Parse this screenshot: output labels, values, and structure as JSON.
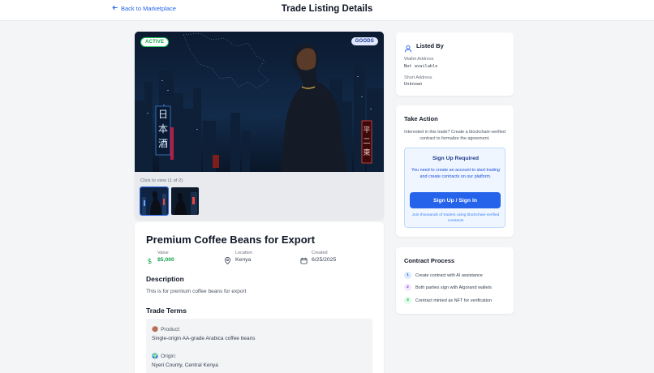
{
  "header": {
    "back_label": "Back to Marketplace",
    "title": "Trade Listing Details"
  },
  "gallery": {
    "status_badge": "ACTIVE",
    "type_badge": "GOODS",
    "thumbs_caption": "Click to view (1 of 2)",
    "hero_sign_left": "日本酒",
    "hero_sign_right": "平二東"
  },
  "listing": {
    "title": "Premium Coffee Beans for Export",
    "value_label": "Value",
    "value": "$5,000",
    "location_label": "Location",
    "location": "Kenya",
    "created_label": "Created",
    "created": "6/25/2025",
    "description_heading": "Description",
    "description": "This is for premium coffee beans for export",
    "terms_heading": "Trade Terms",
    "terms": [
      {
        "icon": "🟤",
        "label": "Product:",
        "value": "Single-origin AA-grade Arabica coffee beans"
      },
      {
        "icon": "🌍",
        "label": "Origin:",
        "value": "Nyeri County, Central Kenya"
      }
    ]
  },
  "listed_by": {
    "title": "Listed By",
    "wallet_label": "Wallet Address",
    "wallet_value": "Not available",
    "short_label": "Short Address",
    "short_value": "Unknown"
  },
  "take_action": {
    "title": "Take Action",
    "description": "Interested in this trade? Create a blockchain-verified contract to formalize the agreement.",
    "signup_title": "Sign Up Required",
    "signup_text": "You need to create an account to start trading and create contracts on our platform.",
    "signup_button": "Sign Up / Sign In",
    "signup_footer": "Join thousands of traders using blockchain-verified contracts"
  },
  "contract_process": {
    "title": "Contract Process",
    "steps": [
      {
        "num": "1",
        "text": "Create contract with AI assistance"
      },
      {
        "num": "2",
        "text": "Both parties sign with Algorand wallets"
      },
      {
        "num": "3",
        "text": "Contract minted as NFT for verification"
      }
    ]
  },
  "colors": {
    "accent": "#2563eb",
    "success": "#16a34a",
    "background": "#f4f5f7"
  }
}
